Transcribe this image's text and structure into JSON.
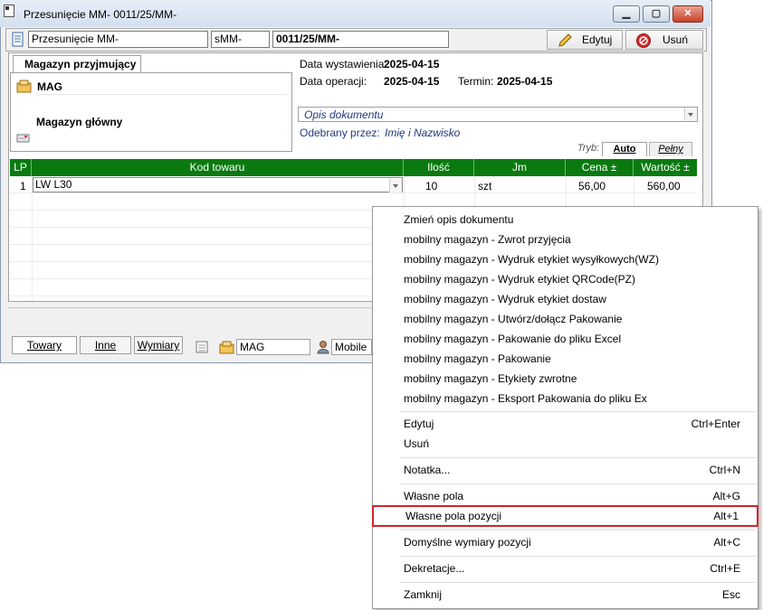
{
  "window": {
    "title": "Przesunięcie MM- 0011/25/MM-",
    "controls": {
      "minimize": "▁",
      "maximize": "▢",
      "close": "✕"
    }
  },
  "toolbar": {
    "doc_type": "Przesunięcie MM-",
    "series": "sMM-",
    "number": "0011/25/MM-",
    "edit_label": "Edytuj",
    "delete_label": "Usuń"
  },
  "warehouse": {
    "tab_label": "Magazyn przyjmujący",
    "code": "MAG",
    "name": "Magazyn główny"
  },
  "dates": {
    "issue_label": "Data wystawienia:",
    "issue_value": "2025-04-15",
    "operation_label": "Data operacji:",
    "operation_value": "2025-04-15",
    "due_label": "Termin:",
    "due_value": "2025-04-15"
  },
  "document": {
    "description_placeholder": "Opis dokumentu",
    "received_by_label": "Odebrany przez:",
    "received_by_placeholder": "Imię i Nazwisko"
  },
  "modes": {
    "label": "Tryb:",
    "auto": "Auto",
    "full": "Pełny"
  },
  "grid": {
    "columns": [
      "LP",
      "Kod towaru",
      "Ilość",
      "Jm",
      "Cena ±",
      "Wartość ±"
    ],
    "rows": [
      {
        "lp": "1",
        "code": "LW L30",
        "qty": "10",
        "unit": "szt",
        "price": "56,00",
        "value": "560,00"
      }
    ]
  },
  "bottom": {
    "tabs": [
      "Towary",
      "Inne",
      "Wymiary"
    ],
    "warehouse": "MAG",
    "user": "Mobile"
  },
  "context_menu": {
    "items": [
      {
        "label": "Zmień opis dokumentu",
        "shortcut": ""
      },
      {
        "label": "mobilny magazyn - Zwrot przyjęcia",
        "shortcut": ""
      },
      {
        "label": "mobilny magazyn - Wydruk etykiet wysyłkowych(WZ)",
        "shortcut": ""
      },
      {
        "label": "mobilny magazyn - Wydruk etykiet QRCode(PZ)",
        "shortcut": ""
      },
      {
        "label": "mobilny magazyn - Wydruk etykiet dostaw",
        "shortcut": ""
      },
      {
        "label": "mobilny magazyn - Utwórz/dołącz Pakowanie",
        "shortcut": ""
      },
      {
        "label": "mobilny magazyn - Pakowanie do pliku Excel",
        "shortcut": ""
      },
      {
        "label": "mobilny magazyn - Pakowanie",
        "shortcut": ""
      },
      {
        "label": "mobilny magazyn - Etykiety zwrotne",
        "shortcut": ""
      },
      {
        "label": "mobilny magazyn - Eksport Pakowania do pliku Ex",
        "shortcut": ""
      },
      {
        "label": "Edytuj",
        "shortcut": "Ctrl+Enter"
      },
      {
        "label": "Usuń",
        "shortcut": ""
      },
      {
        "label": "Notatka...",
        "shortcut": "Ctrl+N"
      },
      {
        "label": "Własne pola",
        "shortcut": "Alt+G"
      },
      {
        "label": "Własne pola pozycji",
        "shortcut": "Alt+1"
      },
      {
        "label": "Domyślne wymiary pozycji",
        "shortcut": "Alt+C"
      },
      {
        "label": "Dekretacje...",
        "shortcut": "Ctrl+E"
      },
      {
        "label": "Zamknij",
        "shortcut": "Esc"
      }
    ]
  },
  "colors": {
    "grid_header": "#0a7a10",
    "highlight_border": "#d0242a"
  }
}
